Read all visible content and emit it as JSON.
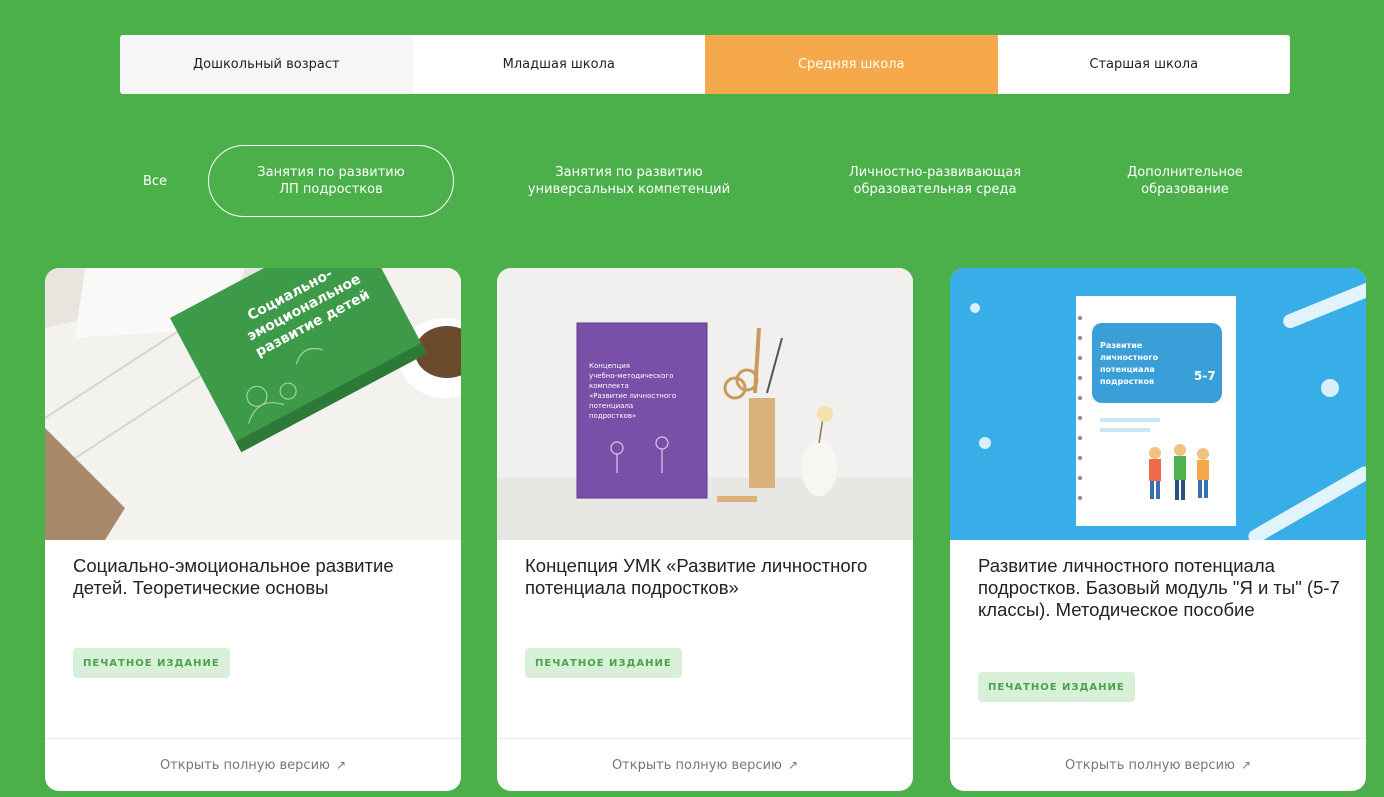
{
  "age_tabs": [
    {
      "label": "Дошкольный возраст"
    },
    {
      "label": "Младшая школа"
    },
    {
      "label": "Средняя школа"
    },
    {
      "label": "Старшая школа"
    }
  ],
  "age_tabs_active": "Средняя школа",
  "filters": [
    {
      "label": "Все"
    },
    {
      "label": "Занятия по развитию\nЛП подростков"
    },
    {
      "label": "Занятия по развитию\nуниверсальных компетенций"
    },
    {
      "label": "Личностно-развивающая\nобразовательная среда"
    },
    {
      "label": "Дополнительное\nобразование"
    }
  ],
  "cards": [
    {
      "image_icon": "green-book-photo",
      "book_cover_text": "Социально-эмоциональное развитие детей",
      "title": "Социально-эмоциональное развитие детей. Теоретические основы",
      "badge": "ПЕЧАТНОЕ ИЗДАНИЕ",
      "link": "Открыть полную версию"
    },
    {
      "image_icon": "purple-book-photo",
      "book_cover_text": "Концепция учебно-методического комплекта «Развитие личностного потенциала подростков»",
      "title": "Концепция УМК «Развитие личностного потенциала подростков»",
      "badge": "ПЕЧАТНОЕ ИЗДАНИЕ",
      "link": "Открыть полную версию"
    },
    {
      "image_icon": "blue-book-photo",
      "book_cover_text": "Развитие личностного потенциала подростков 5-7",
      "title": "Развитие личностного потенциала подростков. Базовый модуль \"Я и ты\" (5-7 классы). Методическое пособие",
      "badge": "ПЕЧАТНОЕ ИЗДАНИЕ",
      "link": "Открыть полную версию"
    }
  ],
  "link_arrow": "↗",
  "colors": {
    "background": "#4cb04a",
    "active_tab": "#f5a94a",
    "badge_bg": "#d9f0d8",
    "badge_text": "#4aa34a"
  }
}
